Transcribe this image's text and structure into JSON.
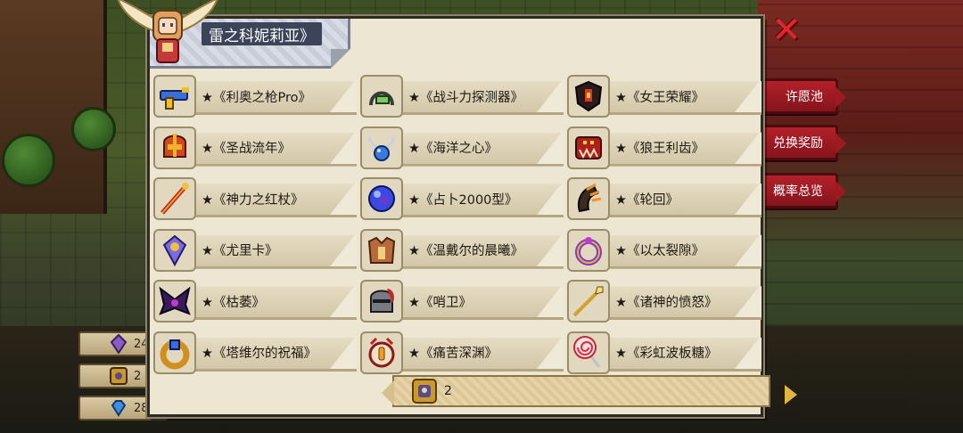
{
  "panel": {
    "title": "雷之科妮莉亚》"
  },
  "side_tabs": [
    {
      "label": "许愿池"
    },
    {
      "label": "兑换奖励"
    },
    {
      "label": "概率总览"
    }
  ],
  "currencies": [
    {
      "icon": "purple-crystal-icon",
      "value": "24"
    },
    {
      "icon": "gold-token-icon",
      "value": "2"
    },
    {
      "icon": "blue-gem-icon",
      "value": "28"
    }
  ],
  "items": [
    {
      "label": "★《利奥之枪Pro》",
      "icon": "blaster-gun-icon"
    },
    {
      "label": "★《战斗力探测器》",
      "icon": "scouter-icon"
    },
    {
      "label": "★《女王荣耀》",
      "icon": "queen-shield-icon"
    },
    {
      "label": "★《圣战流年》",
      "icon": "crusade-helmet-icon"
    },
    {
      "label": "★《海洋之心》",
      "icon": "ocean-heart-necklace-icon"
    },
    {
      "label": "★《狼王利齿》",
      "icon": "wolf-king-fang-icon"
    },
    {
      "label": "★《神力之红杖》",
      "icon": "red-staff-icon"
    },
    {
      "label": "★《占卜2000型》",
      "icon": "crystal-ball-icon"
    },
    {
      "label": "★《轮回》",
      "icon": "claw-icon"
    },
    {
      "label": "★《尤里卡》",
      "icon": "eureka-amulet-icon"
    },
    {
      "label": "★《温戴尔的晨曦》",
      "icon": "dawn-armor-icon"
    },
    {
      "label": "★《以太裂隙》",
      "icon": "ether-ring-icon"
    },
    {
      "label": "★《枯萎》",
      "icon": "withered-wings-icon"
    },
    {
      "label": "★《哨卫》",
      "icon": "sentinel-helmet-icon"
    },
    {
      "label": "★《诸神的愤怒》",
      "icon": "wrath-spear-icon"
    },
    {
      "label": "★《塔维尔的祝福》",
      "icon": "blessing-ring-icon"
    },
    {
      "label": "★《痛苦深渊》",
      "icon": "abyss-emblem-icon"
    },
    {
      "label": "★《彩虹波板糖》",
      "icon": "lollipop-icon"
    }
  ],
  "footer": {
    "count": "2",
    "icon": "gold-token-icon"
  },
  "colors": {
    "panel_bg": "#ece6d3",
    "title_bg": "#3b4458",
    "close": "#e2262c",
    "tab_red": "#b3202a"
  }
}
